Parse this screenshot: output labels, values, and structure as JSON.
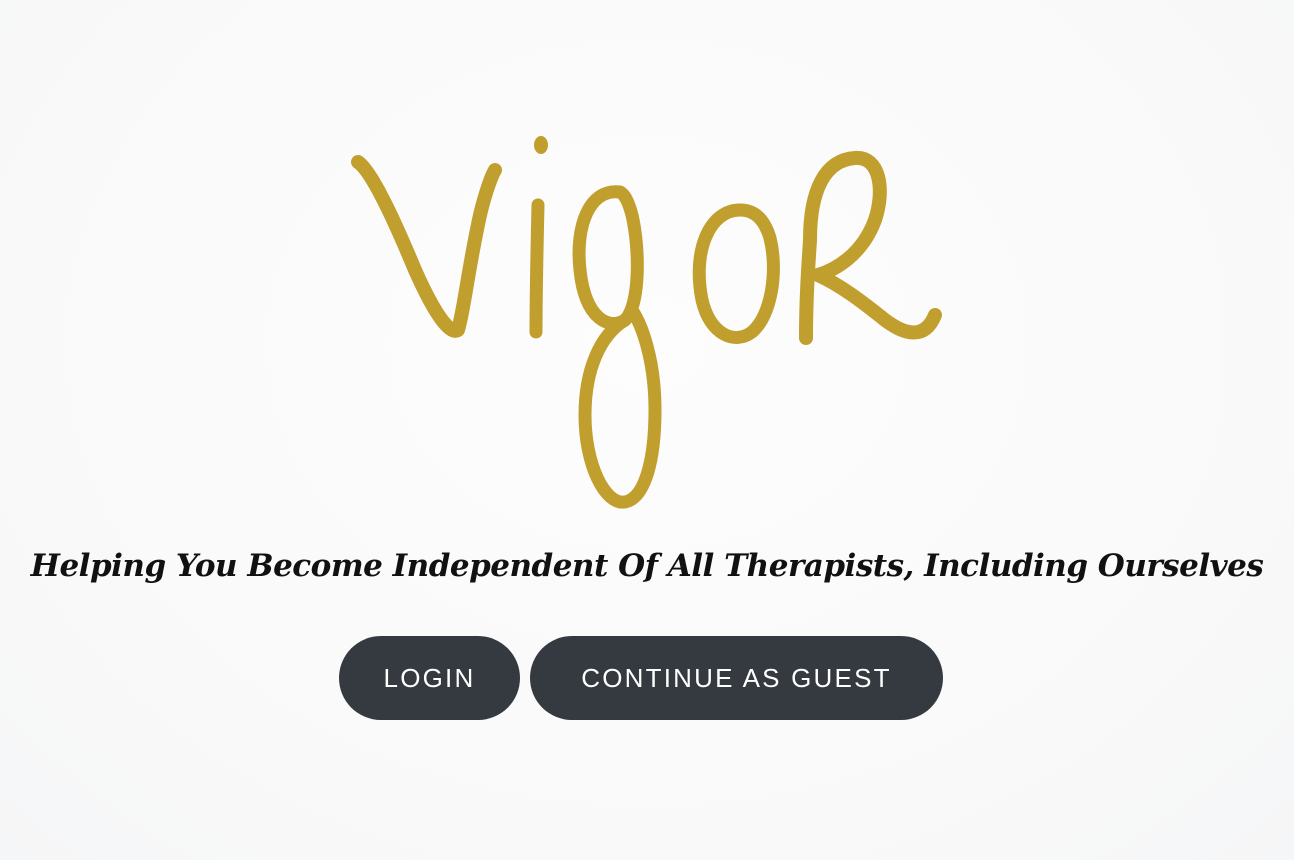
{
  "brand": {
    "logo_text": "Vigor",
    "logo_color": "#c19f2e"
  },
  "tagline": "Helping You Become Independent Of All Therapists, Including Ourselves",
  "actions": {
    "login_label": "LOGIN",
    "guest_label": "CONTINUE AS GUEST",
    "button_color": "#343a40",
    "button_text_color": "#ffffff"
  }
}
